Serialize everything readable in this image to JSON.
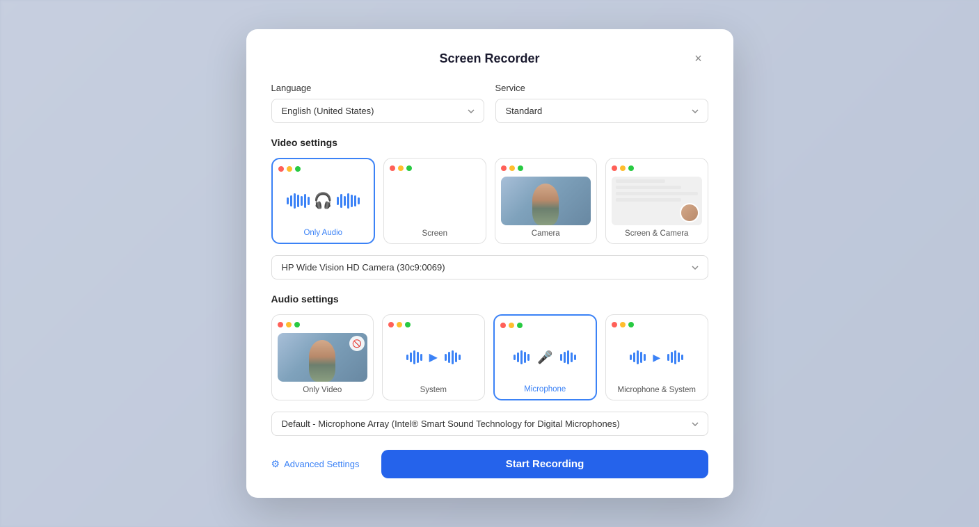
{
  "modal": {
    "title": "Screen Recorder",
    "close_label": "×"
  },
  "language": {
    "label": "Language",
    "value": "English (United States)"
  },
  "service": {
    "label": "Service",
    "value": "Standard"
  },
  "video_settings": {
    "label": "Video settings",
    "options": [
      {
        "id": "only-audio",
        "label": "Only Audio",
        "selected": true
      },
      {
        "id": "screen",
        "label": "Screen",
        "selected": false
      },
      {
        "id": "camera",
        "label": "Camera",
        "selected": false
      },
      {
        "id": "screen-camera",
        "label": "Screen & Camera",
        "selected": false
      }
    ],
    "camera_select": {
      "value": "HP Wide Vision HD Camera (30c9:0069)"
    }
  },
  "audio_settings": {
    "label": "Audio settings",
    "options": [
      {
        "id": "only-video",
        "label": "Only Video",
        "selected": false
      },
      {
        "id": "system",
        "label": "System",
        "selected": false
      },
      {
        "id": "microphone",
        "label": "Microphone",
        "selected": true
      },
      {
        "id": "microphone-system",
        "label": "Microphone & System",
        "selected": false
      }
    ],
    "microphone_select": {
      "value": "Default - Microphone Array (Intel® Smart Sound Technology for Digital Microphones)"
    }
  },
  "footer": {
    "advanced_settings_label": "Advanced Settings",
    "start_recording_label": "Start Recording"
  }
}
